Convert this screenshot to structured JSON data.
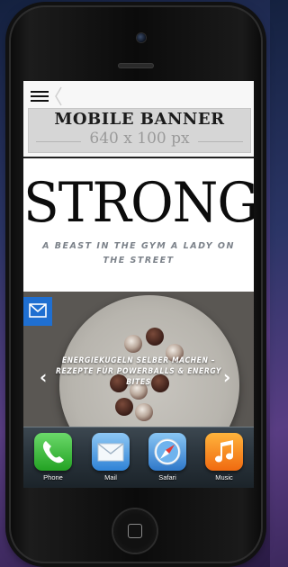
{
  "banner": {
    "title": "MOBILE BANNER",
    "size": "640 x 100 px"
  },
  "hero": {
    "logo": "STRONG",
    "tagline": "A BEAST IN THE GYM A LADY ON THE STREET"
  },
  "slider": {
    "caption": "ENERGIEKUGELN SELBER MACHEN – REZEPTE FÜR POWERBALLS & ENERGY BITES",
    "prev_symbol": "‹",
    "next_symbol": "›"
  },
  "dock": {
    "apps": [
      {
        "label": "Phone",
        "icon": "phone-icon"
      },
      {
        "label": "Mail",
        "icon": "mail-icon"
      },
      {
        "label": "Safari",
        "icon": "safari-icon"
      },
      {
        "label": "Music",
        "icon": "music-icon"
      }
    ]
  },
  "colors": {
    "accent": "#1f6fd1",
    "tagline": "#7c828a",
    "logo": "#0c0c0c"
  }
}
